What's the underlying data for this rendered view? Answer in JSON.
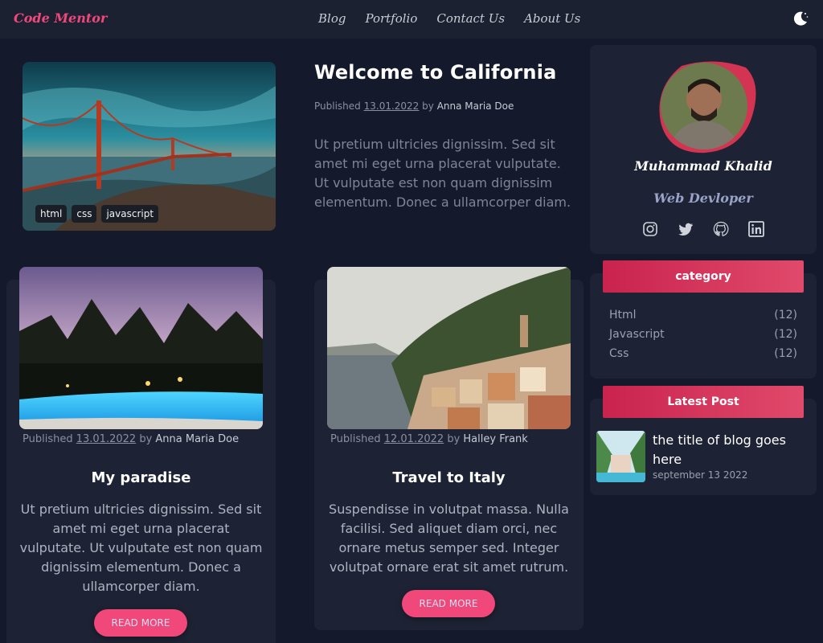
{
  "nav": {
    "brand": "Code Mentor",
    "links": [
      "Blog",
      "Portfolio",
      "Contact Us",
      "About Us"
    ],
    "theme_icon": "moon-icon"
  },
  "hero": {
    "title": "Welcome to California",
    "meta": {
      "prefix": "Published",
      "date": "13.01.2022",
      "by": "by",
      "author": "Anna Maria Doe"
    },
    "text": "Ut pretium ultricies dignissim. Sed sit amet mi eget urna placerat vulputate. Ut vulputate est non quam dignissim elementum. Donec a ullamcorper diam.",
    "tags": [
      "html",
      "css",
      "javascript"
    ]
  },
  "posts": [
    {
      "meta": {
        "prefix": "Published",
        "date": "13.01.2022",
        "by": "by",
        "author": "Anna Maria Doe"
      },
      "title": "My paradise",
      "text": "Ut pretium ultricies dignissim. Sed sit amet mi eget urna placerat vulputate. Ut vulputate est non quam dignissim elementum. Donec a ullamcorper diam.",
      "button": "READ MORE"
    },
    {
      "meta": {
        "prefix": "Published",
        "date": "12.01.2022",
        "by": "by",
        "author": "Halley Frank"
      },
      "title": "Travel to Italy",
      "text": "Suspendisse in volutpat massa. Nulla facilisi. Sed aliquet diam orci, nec ornare metus semper sed. Integer volutpat ornare erat sit amet rutrum.",
      "button": "READ MORE"
    }
  ],
  "profile": {
    "name": "Muhammad Khalid",
    "role": "Web Devloper",
    "socials": [
      "instagram-icon",
      "twitter-icon",
      "github-icon",
      "linkedin-icon"
    ]
  },
  "category": {
    "heading": "category",
    "items": [
      {
        "label": "Html",
        "count": "(12)"
      },
      {
        "label": "Javascript",
        "count": "(12)"
      },
      {
        "label": "Css",
        "count": "(12)"
      }
    ]
  },
  "latest": {
    "heading": "Latest Post",
    "title": "the title of blog goes here",
    "date": "september 13 2022"
  },
  "colors": {
    "background": "#141a2b",
    "card": "#1d2334",
    "accent": "#f0487a",
    "pill": "#d4304f"
  }
}
